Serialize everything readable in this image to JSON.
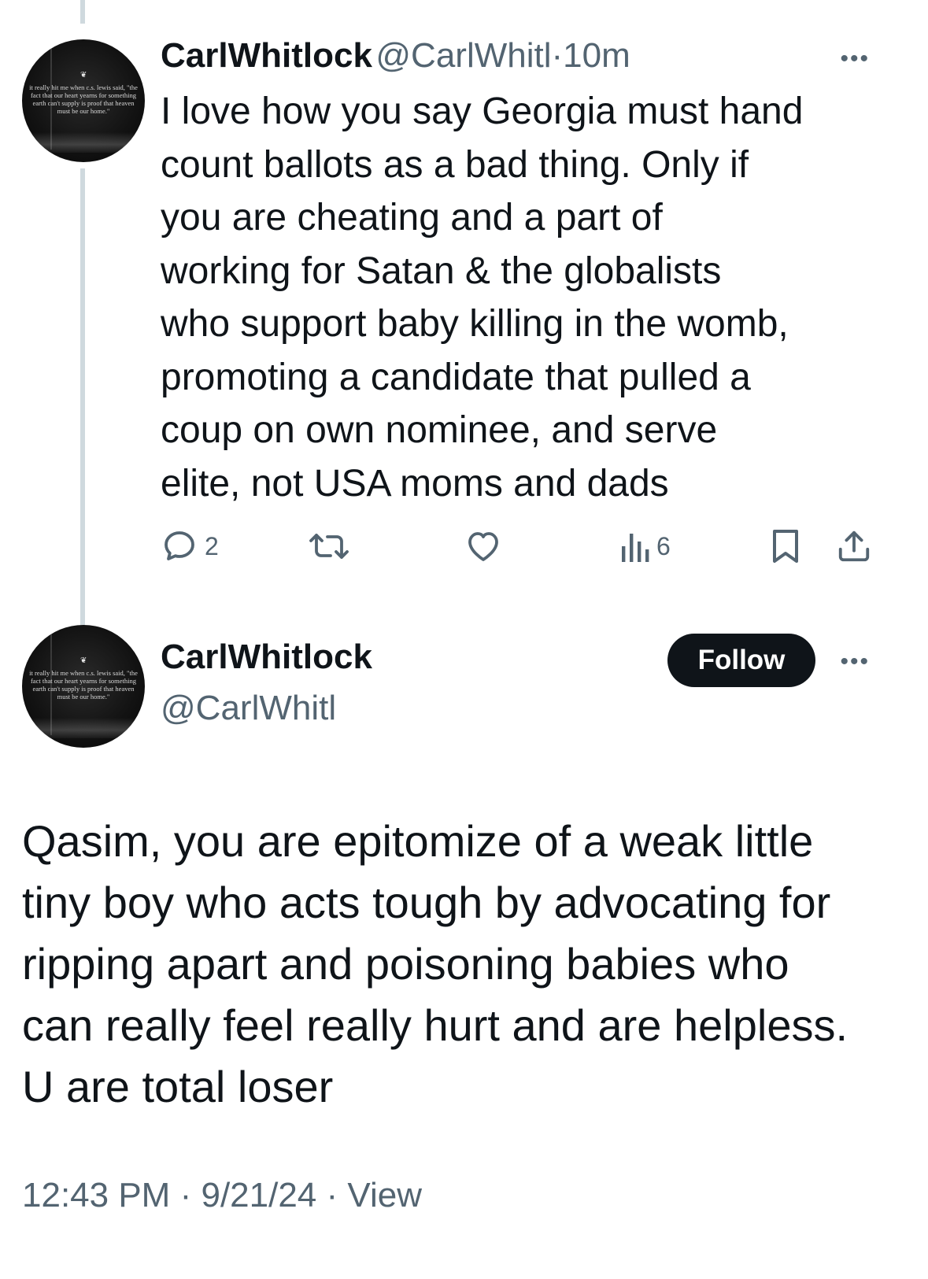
{
  "tweet1": {
    "display_name": "CarlWhitlock",
    "handle": "@CarlWhitl",
    "time": "10m",
    "separator": "·",
    "more_icon": "more-horizontal-icon",
    "text": "I love how you say Georgia must hand\ncount ballots as a bad thing. Only if\nyou are cheating and a part of\nworking for Satan & the globalists\nwho support baby killing in the womb,\npromoting a candidate that pulled a\ncoup on own nominee, and serve\nelite, not USA moms and dads",
    "actions": {
      "reply_count": "2",
      "repost_count": "",
      "like_count": "",
      "views_count": "6"
    }
  },
  "avatar_quote": "it really hit me when c.s. lewis said, \"the fact that our heart yearns for something earth can't supply is proof that heaven must be our home.\"",
  "tweet2": {
    "display_name": "CarlWhitlock",
    "handle": "@CarlWhitl",
    "follow_label": "Follow",
    "text": "Qasim, you are epitomize of a weak little\ntiny boy who acts tough by advocating for\nripping apart and poisoning babies who\ncan really feel really hurt and are helpless.\nU are total loser",
    "time": "12:43 PM",
    "date": "9/21/24",
    "view_label": "View",
    "separator": "·"
  },
  "colors": {
    "text": "#0f1419",
    "secondary": "#536471",
    "thread_line": "#cfd9de",
    "button_bg": "#0f1419"
  }
}
